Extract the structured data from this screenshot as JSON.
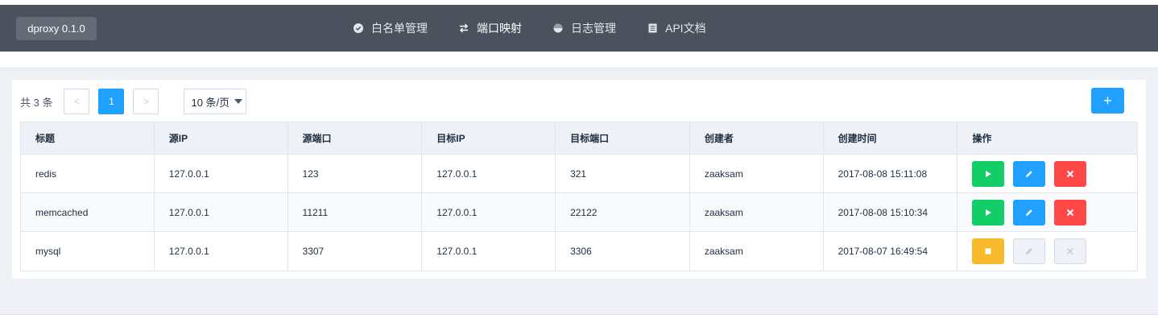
{
  "app": {
    "brand": "dproxy 0.1.0"
  },
  "nav": [
    {
      "label": "白名单管理",
      "icon": "check-circle-icon",
      "active": false
    },
    {
      "label": "端口映射",
      "icon": "swap-arrows-icon",
      "active": true
    },
    {
      "label": "日志管理",
      "icon": "pie-chart-icon",
      "active": false
    },
    {
      "label": "API文档",
      "icon": "document-icon",
      "active": false
    }
  ],
  "pager": {
    "total": "共 3 条",
    "current": "1",
    "page_size": "10 条/页",
    "prev": "<",
    "next": ">"
  },
  "toolbar": {
    "add_label": "+"
  },
  "table": {
    "columns": [
      "标题",
      "源IP",
      "源端口",
      "目标IP",
      "目标端口",
      "创建者",
      "创建时间",
      "操作"
    ],
    "rows": [
      {
        "title": "redis",
        "src_ip": "127.0.0.1",
        "src_port": "123",
        "dst_ip": "127.0.0.1",
        "dst_port": "321",
        "creator": "zaaksam",
        "created": "2017-08-08 15:11:08",
        "running": false
      },
      {
        "title": "memcached",
        "src_ip": "127.0.0.1",
        "src_port": "11211",
        "dst_ip": "127.0.0.1",
        "dst_port": "22122",
        "creator": "zaaksam",
        "created": "2017-08-08 15:10:34",
        "running": false
      },
      {
        "title": "mysql",
        "src_ip": "127.0.0.1",
        "src_port": "3307",
        "dst_ip": "127.0.0.1",
        "dst_port": "3306",
        "creator": "zaaksam",
        "created": "2017-08-07 16:49:54",
        "running": true
      }
    ]
  },
  "colors": {
    "topbar": "#4b515d",
    "primary": "#20a0ff",
    "success": "#13ce66",
    "danger": "#ff4949",
    "warning": "#f7ba2a"
  }
}
